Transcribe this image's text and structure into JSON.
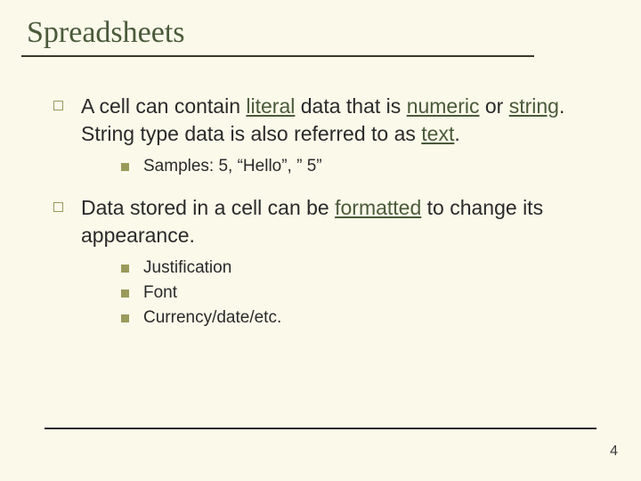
{
  "title": "Spreadsheets",
  "bullets": [
    {
      "prefix1": "A cell can contain ",
      "term1": "literal",
      "mid1": " data that is ",
      "term2": "numeric",
      "mid2": " or ",
      "term3": "string",
      "suffix": ". String type data is also referred to as ",
      "term4": "text",
      "end": ".",
      "sub": [
        "Samples: 5, “Hello”, ” 5”"
      ]
    },
    {
      "prefix1": "Data stored in a cell can be ",
      "term1": "formatted",
      "suffix": " to change its appearance.",
      "sub": [
        "Justification",
        "Font",
        "Currency/date/etc."
      ]
    }
  ],
  "page_number": "4"
}
